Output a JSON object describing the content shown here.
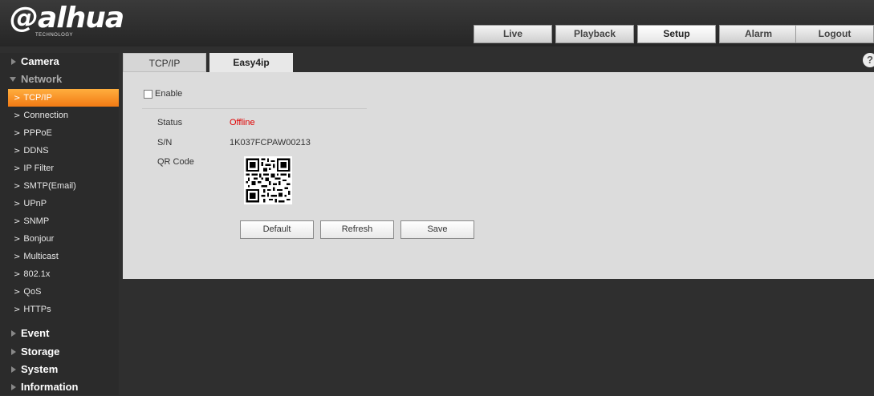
{
  "logo": {
    "main": "alhua",
    "sub": "TECHNOLOGY"
  },
  "top_nav": [
    {
      "label": "Live"
    },
    {
      "label": "Playback"
    },
    {
      "label": "Setup",
      "active": true
    },
    {
      "label": "Alarm"
    },
    {
      "label": "Logout"
    }
  ],
  "sidebar": {
    "categories": {
      "camera": "Camera",
      "network": "Network",
      "event": "Event",
      "storage": "Storage",
      "system": "System",
      "information": "Information"
    },
    "network_items": [
      "TCP/IP",
      "Connection",
      "PPPoE",
      "DDNS",
      "IP Filter",
      "SMTP(Email)",
      "UPnP",
      "SNMP",
      "Bonjour",
      "Multicast",
      "802.1x",
      "QoS",
      "HTTPs"
    ],
    "active_item": "TCP/IP"
  },
  "content_tabs": [
    {
      "label": "TCP/IP"
    },
    {
      "label": "Easy4ip",
      "active": true
    }
  ],
  "help": {
    "glyph": "?"
  },
  "form": {
    "enable_label": "Enable",
    "enable_checked": false,
    "status_label": "Status",
    "status_value": "Offline",
    "sn_label": "S/N",
    "sn_value": "1K037FCPAW00213",
    "qr_label": "QR Code"
  },
  "buttons": {
    "default": "Default",
    "refresh": "Refresh",
    "save": "Save"
  },
  "colors": {
    "accent": "#f27a14",
    "status_offline": "#e00000",
    "background": "#2f2f2f",
    "panel": "#dcdcdc"
  }
}
